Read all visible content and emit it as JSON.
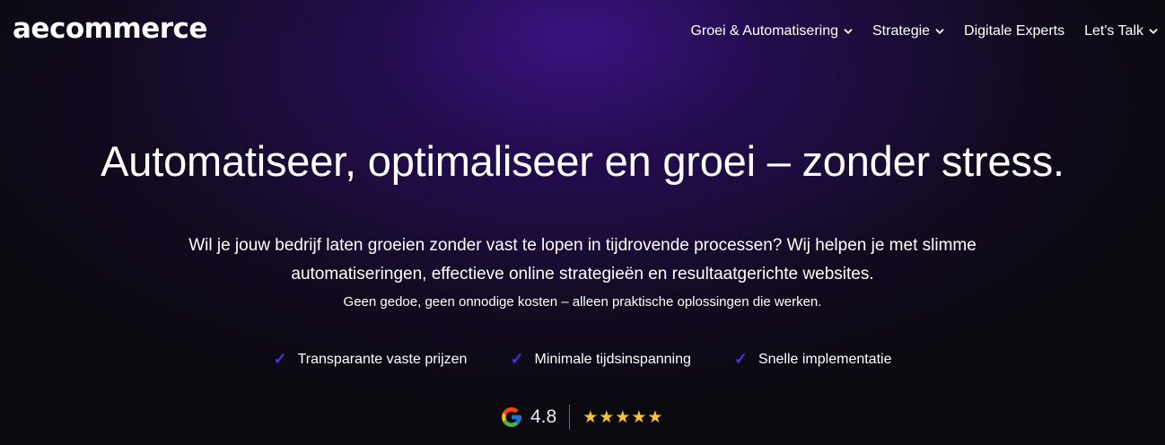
{
  "brand": {
    "logo_text": "aecommerce"
  },
  "nav": {
    "items": [
      {
        "label": "Groei & Automatisering",
        "has_dropdown": true
      },
      {
        "label": "Strategie",
        "has_dropdown": true
      },
      {
        "label": "Digitale Experts",
        "has_dropdown": false
      },
      {
        "label": "Let's Talk",
        "has_dropdown": true
      }
    ]
  },
  "hero": {
    "title": "Automatiseer, optimaliseer en groei – zonder stress.",
    "lead_line1": "Wil je jouw bedrijf laten groeien zonder vast te lopen in tijdrovende processen? Wij helpen je met slimme",
    "lead_line2": "automatiseringen, effectieve online strategieën en resultaatgerichte websites.",
    "sub": "Geen gedoe, geen onnodige kosten – alleen praktische oplossingen die werken."
  },
  "features": [
    {
      "icon": "check-icon",
      "label": "Transparante vaste prijzen"
    },
    {
      "icon": "check-icon",
      "label": "Minimale tijdsinspanning"
    },
    {
      "icon": "check-icon",
      "label": "Snelle implementatie"
    }
  ],
  "rating": {
    "icon": "google-icon",
    "value": "4.8",
    "stars": 5
  },
  "colors": {
    "accent_check": "#4a33e0",
    "star": "#f5c23a",
    "background": "#0b0a10",
    "glow": "#3c148c"
  }
}
